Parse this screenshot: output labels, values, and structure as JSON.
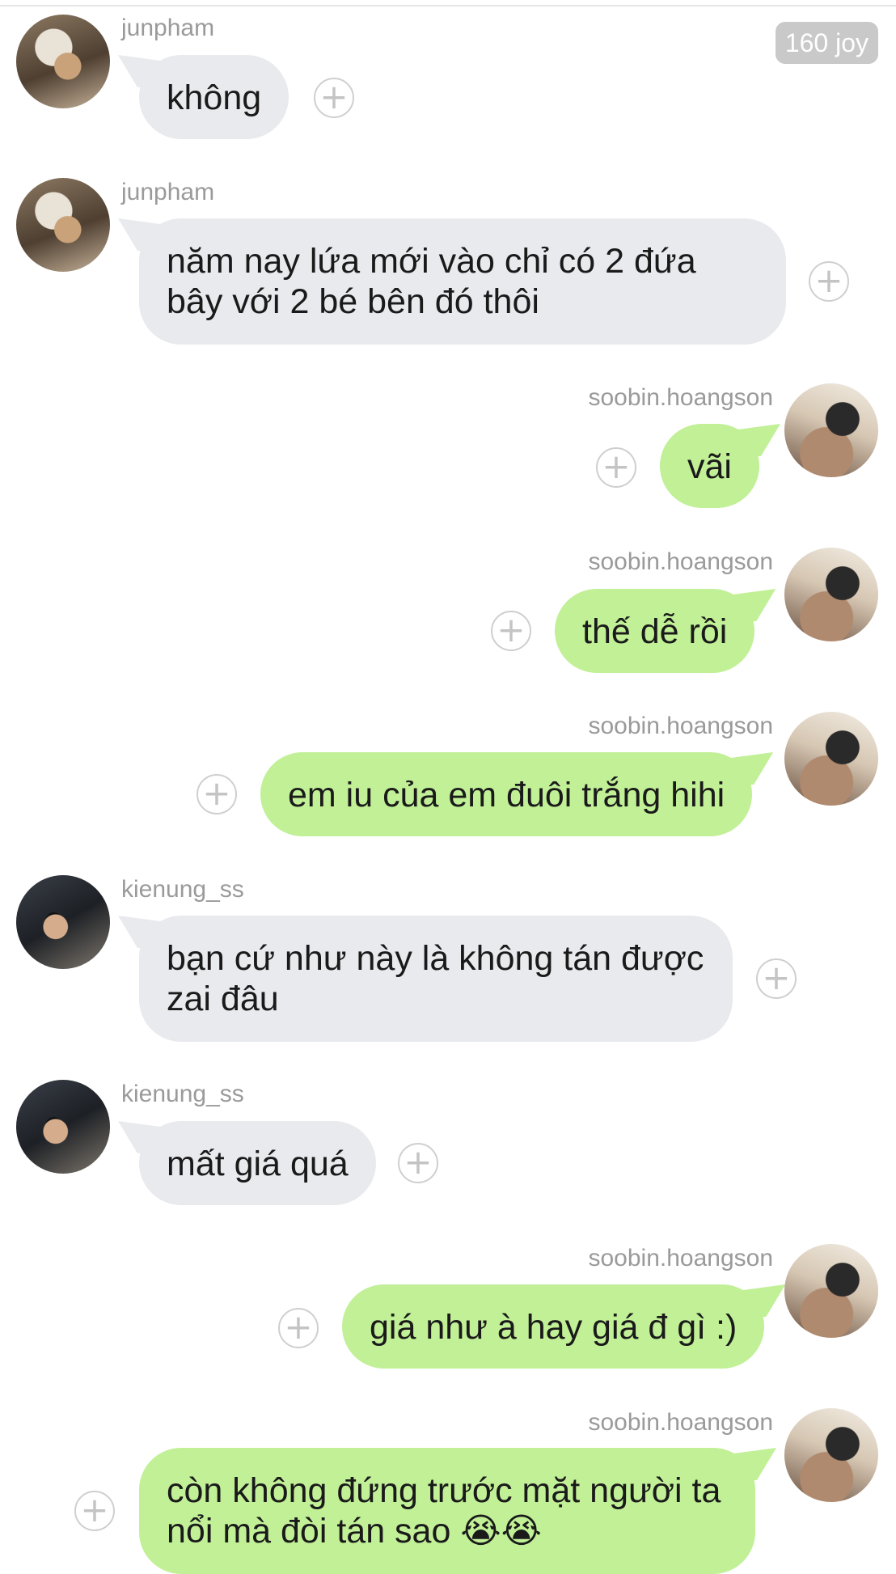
{
  "badge": {
    "label": "160 joy"
  },
  "messages": [
    {
      "user": "junpham",
      "text": "không"
    },
    {
      "user": "junpham",
      "text": "năm nay lứa mới vào chỉ có 2 đứa bây với 2 bé bên đó thôi"
    },
    {
      "user": "soobin.hoangson",
      "text": "vãi"
    },
    {
      "user": "soobin.hoangson",
      "text": "thế dễ rồi"
    },
    {
      "user": "soobin.hoangson",
      "text": "em iu của em đuôi trắng hihi"
    },
    {
      "user": "kienung_ss",
      "text": "bạn cứ như này là không tán được zai đâu"
    },
    {
      "user": "kienung_ss",
      "text": "mất giá quá"
    },
    {
      "user": "soobin.hoangson",
      "text": "giá như à hay giá đ gì :)"
    },
    {
      "user": "soobin.hoangson",
      "text": "còn không đứng trước mặt người ta nổi mà đòi tán sao 😭😭"
    }
  ],
  "icons": {
    "react": "plus-circle-icon",
    "react_glyph": "+"
  }
}
